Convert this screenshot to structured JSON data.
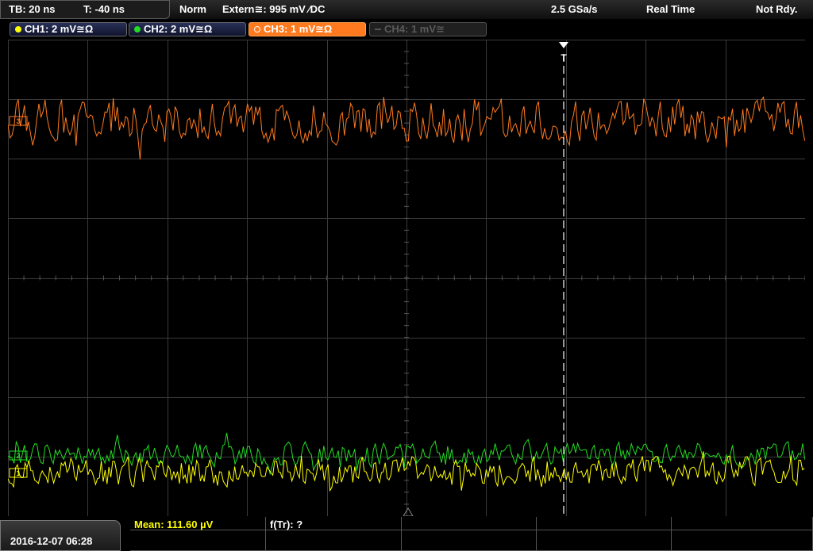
{
  "topbar": {
    "timebase": "TB: 20 ns",
    "trigger_time": "T: -40 ns",
    "trigger_mode": "Norm",
    "trigger_source": "Extern≅: 995 mV ⁄DC",
    "sample_rate": "2.5 GSa/s",
    "acquisition_mode": "Real Time",
    "status": "Not Rdy."
  },
  "channels": [
    {
      "label": "CH1: 2 mV≅Ω",
      "color": "#ffff00",
      "state": "on"
    },
    {
      "label": "CH2: 2 mV≅Ω",
      "color": "#22dd22",
      "state": "on"
    },
    {
      "label": "CH3: 1 mV≅Ω",
      "color": "#ff7a1e",
      "state": "selected"
    },
    {
      "label": "CH4: 1 mV≅",
      "color": "#555555",
      "state": "off"
    }
  ],
  "waveform_markers": {
    "ch3": "3",
    "ch2": "2",
    "ch1": "1",
    "trigger": "T"
  },
  "bottombar": {
    "datetime": "2016-12-07 06:28",
    "measurement_1": "Mean: 111.60 µV",
    "measurement_2": "f(Tr): ?"
  },
  "colors": {
    "ch1": "#ffff00",
    "ch2": "#22dd22",
    "ch3": "#ff7a1e",
    "grid": "#3a3a3a",
    "trigger_line": "#ffffff",
    "measure_text": "#ffff00"
  }
}
